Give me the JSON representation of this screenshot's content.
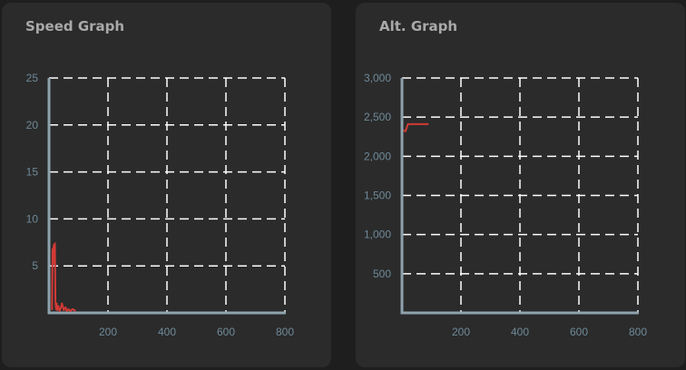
{
  "colors": {
    "axis": "#8fa3ad",
    "grid": "#ffffff",
    "line": "#d23a35",
    "tick": "#6e8a99",
    "title": "#a9a9a9"
  },
  "speed": {
    "title": "Speed Graph"
  },
  "alt": {
    "title": "Alt. Graph"
  },
  "chart_data": [
    {
      "type": "line",
      "title": "Speed Graph",
      "xlim": [
        0,
        800
      ],
      "ylim": [
        0,
        25
      ],
      "x_ticks": [
        200,
        400,
        600,
        800
      ],
      "y_ticks": [
        5,
        10,
        15,
        20,
        25
      ],
      "x_tick_labels": [
        "200",
        "400",
        "600",
        "800"
      ],
      "y_tick_labels": [
        "5",
        "10",
        "15",
        "20",
        "25"
      ],
      "grid": true,
      "series": [
        {
          "x": [
            10,
            12,
            14,
            16,
            18,
            20,
            22,
            24,
            26,
            28,
            32,
            36,
            40,
            44,
            50,
            56,
            60,
            66,
            72,
            80,
            90
          ],
          "y": [
            0.3,
            6.8,
            5.8,
            7.2,
            5.2,
            7.4,
            1.2,
            0.4,
            1.0,
            0.3,
            0.7,
            0.2,
            0.5,
            1.0,
            0.3,
            0.6,
            0.2,
            0.4,
            0.2,
            0.4,
            0.2
          ]
        }
      ]
    },
    {
      "type": "line",
      "title": "Alt. Graph",
      "xlim": [
        0,
        800
      ],
      "ylim": [
        0,
        3000
      ],
      "x_ticks": [
        200,
        400,
        600,
        800
      ],
      "y_ticks": [
        500,
        1000,
        1500,
        2000,
        2500,
        3000
      ],
      "x_tick_labels": [
        "200",
        "400",
        "600",
        "800"
      ],
      "y_tick_labels": [
        "500",
        "1,000",
        "1,500",
        "2,000",
        "2,500",
        "3,000"
      ],
      "grid": true,
      "series": [
        {
          "x": [
            5,
            12,
            20,
            30,
            60,
            90
          ],
          "y": [
            2330,
            2320,
            2410,
            2410,
            2410,
            2410
          ]
        }
      ]
    }
  ]
}
